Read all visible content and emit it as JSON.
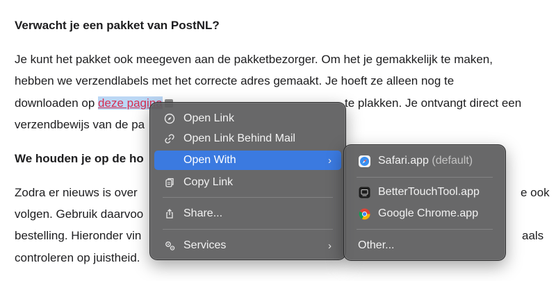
{
  "document": {
    "heading1": "Verwacht je een pakket van PostNL?",
    "para1": {
      "line1": "Je kunt het pakket ook meegeven aan de pakketbezorger. Om het je gemakkelijk te maken,",
      "line2": "hebben we verzendlabels met het correcte adres gemaakt. Je hoeft ze alleen nog te",
      "line3_before": "downloaden op ",
      "line3_link": "deze pagina",
      "line3_after": "printen en op de verpakking te plakken. Je ontvangt direct een",
      "line3_visible_tail": " te plakken. Je ontvangt direct een",
      "line4": "verzendbewijs van de pa"
    },
    "heading2": "We houden je op de ho",
    "para2": {
      "line1_left": "Zodra er nieuws is over",
      "line1_right": "e ook",
      "line2_left": "volgen. Gebruik daarvoo",
      "line3_left": "bestelling. Hieronder vin",
      "line3_right": "aals",
      "line4": "controleren op juistheid."
    }
  },
  "context_menu": {
    "items": [
      {
        "label": "Open Link",
        "icon": "compass-icon"
      },
      {
        "label": "Open Link Behind Mail",
        "icon": "link-icon"
      },
      {
        "label": "Open With",
        "icon": "none",
        "has_submenu": true,
        "active": true
      },
      {
        "label": "Copy Link",
        "icon": "copy-icon"
      },
      {
        "label": "Share...",
        "icon": "share-icon"
      },
      {
        "label": "Services",
        "icon": "gears-icon",
        "has_submenu": true
      }
    ],
    "chevron": "›"
  },
  "submenu": {
    "items": [
      {
        "label": "Safari.app",
        "suffix": "(default)",
        "icon": "safari-icon"
      },
      {
        "label": "BetterTouchTool.app",
        "icon": "bettertouchtool-icon"
      },
      {
        "label": "Google Chrome.app",
        "icon": "chrome-icon"
      },
      {
        "label": "Other..."
      }
    ]
  },
  "colors": {
    "link": "#d62f52",
    "highlight": "#3b7ae0",
    "menu_bg": "#5c5c5e"
  }
}
